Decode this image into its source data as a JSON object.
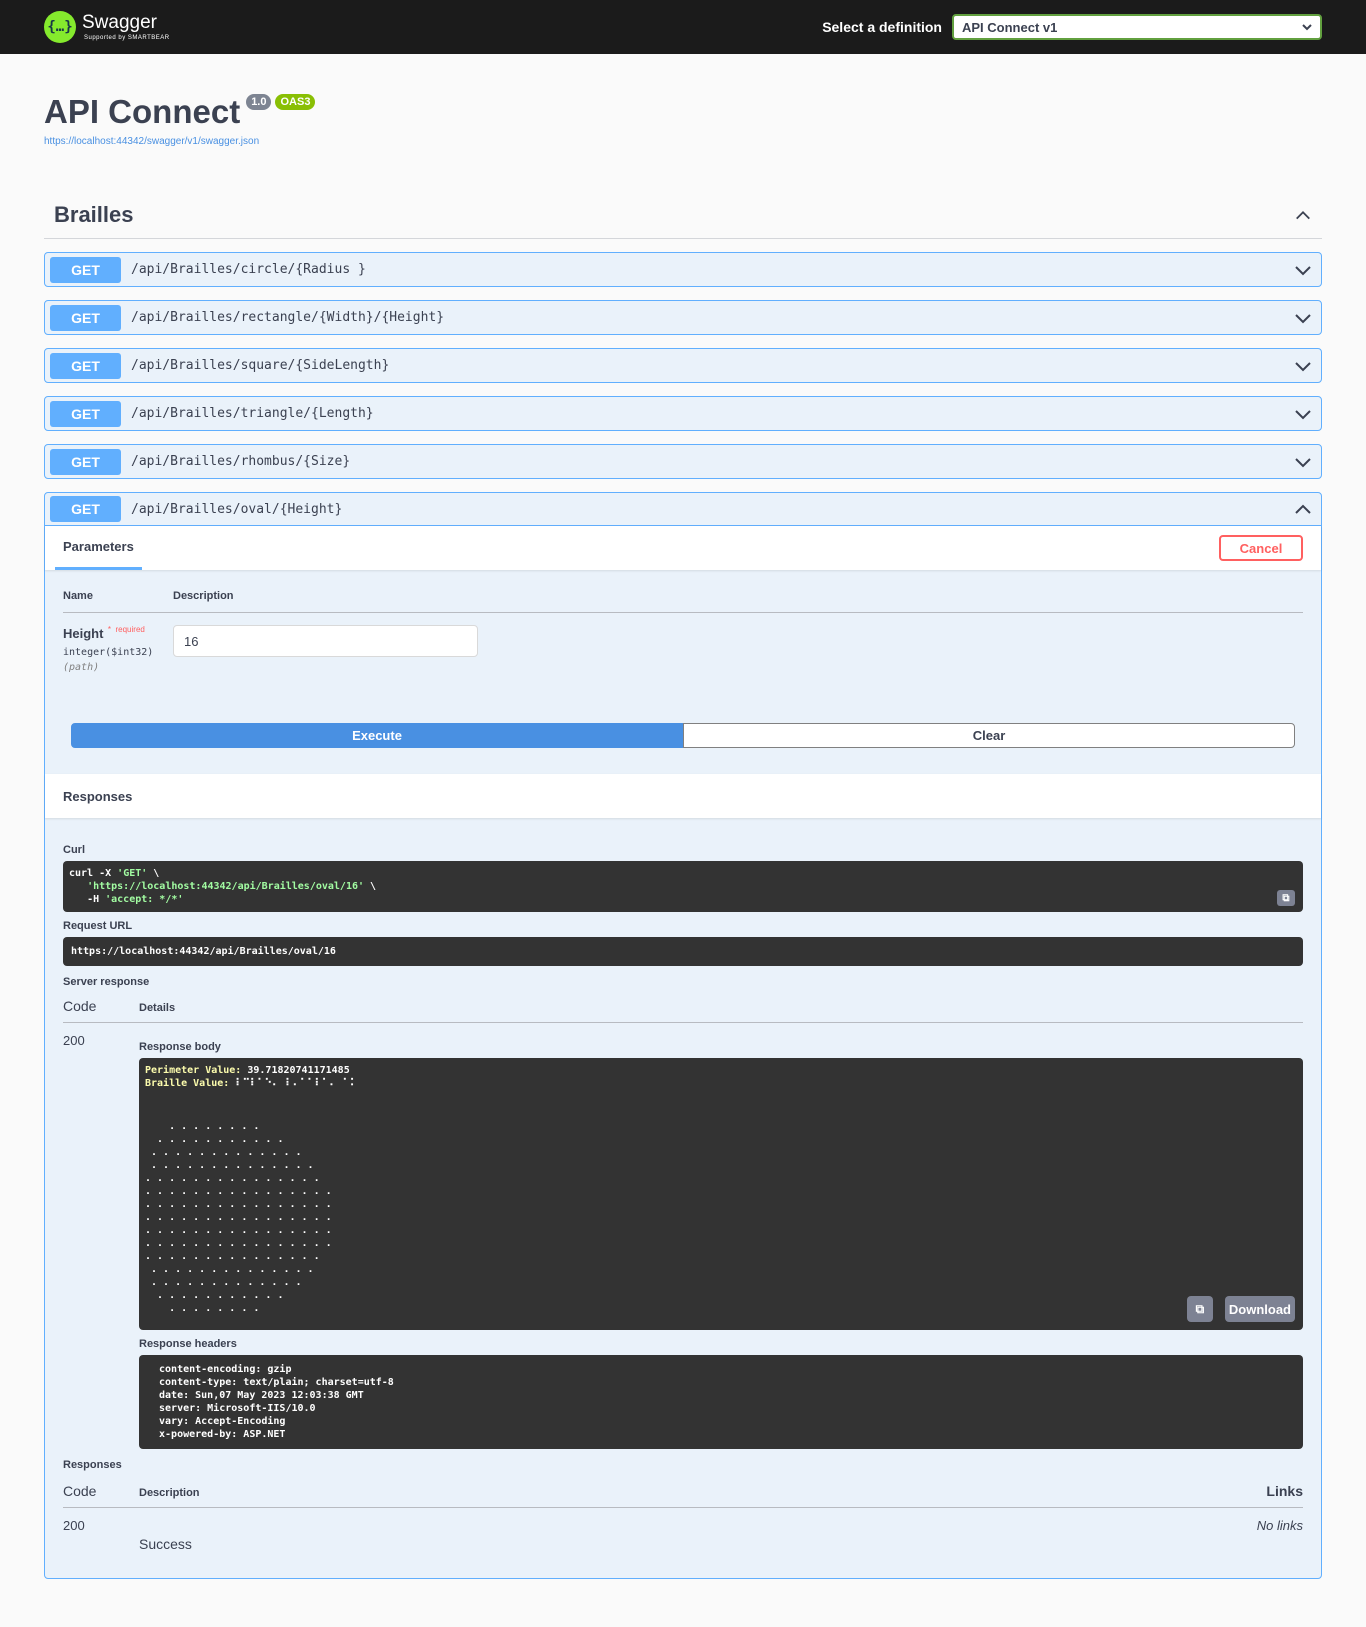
{
  "topbar": {
    "logo_title": "Swagger",
    "logo_sub": "Supported by SMARTBEAR",
    "select_label": "Select a definition",
    "selected_definition": "API Connect v1"
  },
  "info": {
    "title": "API Connect",
    "version": "1.0",
    "oas": "OAS3",
    "spec_url": "https://localhost:44342/swagger/v1/swagger.json"
  },
  "tag": {
    "name": "Brailles"
  },
  "operations": [
    {
      "method": "GET",
      "path": "/api/Brailles/circle/{Radius }"
    },
    {
      "method": "GET",
      "path": "/api/Brailles/rectangle/{Width}/{Height}"
    },
    {
      "method": "GET",
      "path": "/api/Brailles/square/{SideLength}"
    },
    {
      "method": "GET",
      "path": "/api/Brailles/triangle/{Length}"
    },
    {
      "method": "GET",
      "path": "/api/Brailles/rhombus/{Size}"
    },
    {
      "method": "GET",
      "path": "/api/Brailles/oval/{Height}"
    }
  ],
  "expanded": {
    "parameters_tab": "Parameters",
    "cancel": "Cancel",
    "col_name": "Name",
    "col_description": "Description",
    "param_name": "Height",
    "param_required_star": "*",
    "param_required": "required",
    "param_type": "integer($int32)",
    "param_in": "(path)",
    "param_value": "16",
    "execute": "Execute",
    "clear": "Clear",
    "responses_header": "Responses",
    "curl_label": "Curl",
    "curl_line1_a": "curl -X ",
    "curl_line1_b": "'GET'",
    "curl_line1_c": " \\",
    "curl_line2": "'https://localhost:44342/api/Brailles/oval/16'",
    "curl_line2_tail": " \\",
    "curl_line3_a": "-H ",
    "curl_line3_b": "'accept: */*'",
    "request_url_label": "Request URL",
    "request_url": "https://localhost:44342/api/Brailles/oval/16",
    "server_response_label": "Server response",
    "code_col": "Code",
    "details_col": "Details",
    "response_code": "200",
    "response_body_label": "Response body",
    "perimeter_key": "Perimeter Value:",
    "perimeter_value": "39.71820741171485",
    "braille_key": "Braille Value:",
    "braille_value": "⠇⠉⠇⠁⠑⠄ ⠇⠄⠁⠁⠇⠁⠄ ⠁⠅",
    "oval_art": "    . . . . . . . .\n  . . . . . . . . . . .\n . . . . . . . . . . . . .\n . . . . . . . . . . . . . .\n. . . . . . . . . . . . . . .\n. . . . . . . . . . . . . . . .\n. . . . . . . . . . . . . . . .\n. . . . . . . . . . . . . . . .\n. . . . . . . . . . . . . . . .\n. . . . . . . . . . . . . . . .\n. . . . . . . . . . . . . . .\n . . . . . . . . . . . . . .\n . . . . . . . . . . . . .\n  . . . . . . . . . . .\n    . . . . . . . .",
    "download": "Download",
    "response_headers_label": "Response headers",
    "response_headers": " content-encoding: gzip\n content-type: text/plain; charset=utf-8\n date: Sun,07 May 2023 12:03:38 GMT\n server: Microsoft-IIS/10.0\n vary: Accept-Encoding\n x-powered-by: ASP.NET",
    "responses_label": "Responses",
    "resp_code_col": "Code",
    "resp_desc_col": "Description",
    "resp_links_col": "Links",
    "resp_code": "200",
    "resp_desc": "Success",
    "resp_links": "No links"
  },
  "colors": {
    "get": "#61affe",
    "execute": "#4990e2",
    "cancel": "#ff6060",
    "logo": "#85ea2d"
  }
}
